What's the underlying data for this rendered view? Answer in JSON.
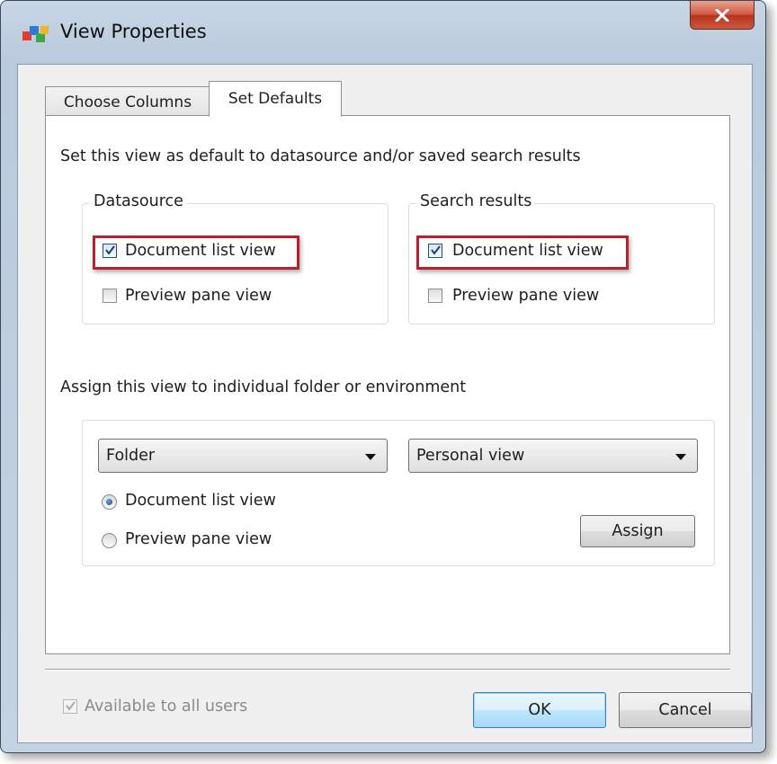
{
  "window": {
    "title": "View Properties"
  },
  "tabs": [
    {
      "label": "Choose Columns",
      "active": false
    },
    {
      "label": "Set Defaults",
      "active": true
    }
  ],
  "set_defaults": {
    "intro": "Set this view as default to datasource and/or saved search results",
    "datasource": {
      "label": "Datasource",
      "document_list_view": {
        "label": "Document list view",
        "checked": true
      },
      "preview_pane_view": {
        "label": "Preview pane view",
        "checked": false
      }
    },
    "search_results": {
      "label": "Search results",
      "document_list_view": {
        "label": "Document list view",
        "checked": true
      },
      "preview_pane_view": {
        "label": "Preview pane view",
        "checked": false
      }
    },
    "assign_heading": "Assign this view to individual folder or environment",
    "assign": {
      "folder_select": "Folder",
      "view_select": "Personal view",
      "radio_document_list": {
        "label": "Document list view",
        "selected": true
      },
      "radio_preview_pane": {
        "label": "Preview pane view",
        "selected": false
      },
      "assign_button": "Assign"
    }
  },
  "footer": {
    "available_all_users": {
      "label": "Available to all users",
      "checked": true,
      "enabled": false
    },
    "ok_button": "OK",
    "cancel_button": "Cancel"
  },
  "colors": {
    "highlight": "#b8202b",
    "default_button": "#3c7fb1"
  },
  "icons": {
    "app": "app-logo-icon",
    "close": "close-icon"
  }
}
